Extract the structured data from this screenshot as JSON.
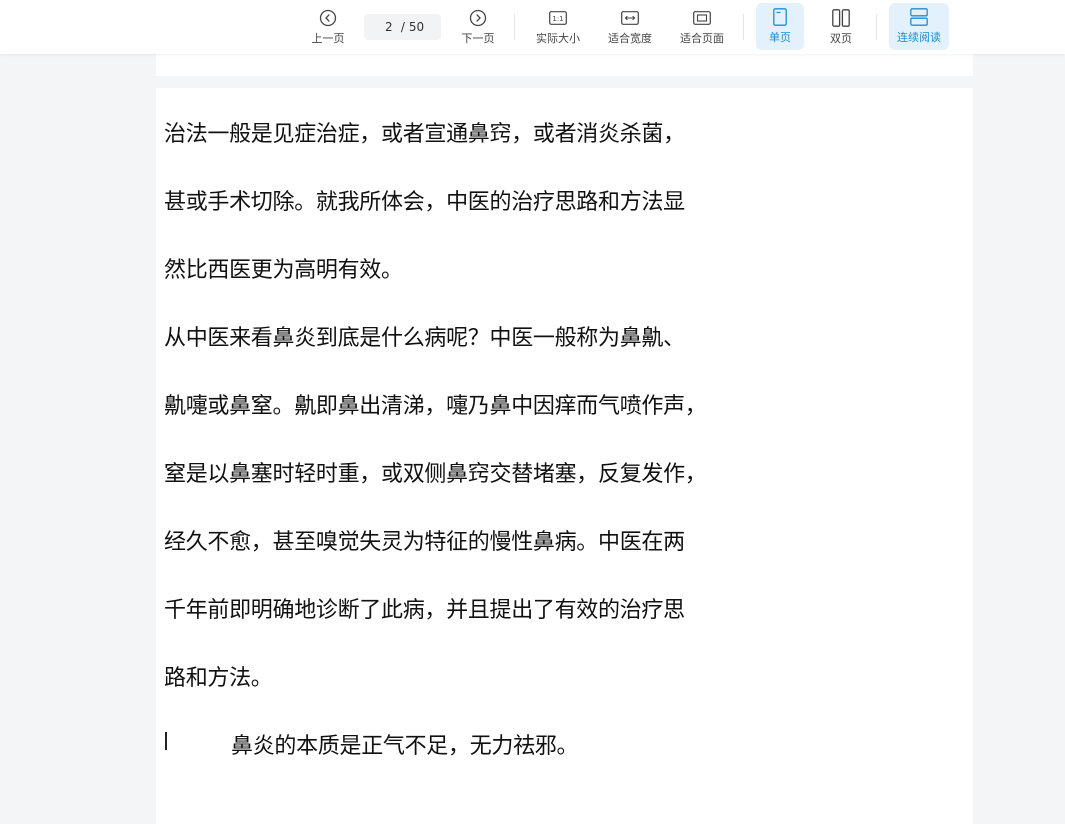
{
  "toolbar": {
    "prev_label": "上一页",
    "current_page": "2",
    "page_separator": "/",
    "total_pages": "50",
    "next_label": "下一页",
    "actual_size_label": "实际大小",
    "actual_size_icon_text": "1:1",
    "fit_width_label": "适合宽度",
    "fit_page_label": "适合页面",
    "single_page_label": "单页",
    "double_page_label": "双页",
    "continuous_label": "连续阅读"
  },
  "colors": {
    "accent": "#1a8fd8",
    "active_bg": "#e2f1fb"
  },
  "icons": {
    "prev": "chevron-left-circle-icon",
    "next": "chevron-right-circle-icon",
    "actual_size": "one-to-one-icon",
    "fit_width": "fit-width-icon",
    "fit_page": "fit-page-icon",
    "single_page": "single-page-icon",
    "double_page": "double-page-icon",
    "continuous": "continuous-scroll-icon"
  },
  "document": {
    "lines": [
      "治法一般是见症治症，或者宣通鼻窍，或者消炎杀菌，",
      "甚或手术切除。就我所体会，中医的治疗思路和方法显",
      "然比西医更为高明有效。",
      "从中医来看鼻炎到底是什么病呢？中医一般称为鼻鼽、",
      "鼽嚏或鼻窒。鼽即鼻出清涕，嚏乃鼻中因痒而气喷作声，",
      "窒是以鼻塞时轻时重，或双侧鼻窍交替堵塞，反复发作，",
      "经久不愈，甚至嗅觉失灵为特征的慢性鼻病。中医在两",
      "千年前即明确地诊断了此病，并且提出了有效的治疗思",
      "路和方法。",
      "鼻炎的本质是正气不足，无力祛邪。"
    ]
  }
}
